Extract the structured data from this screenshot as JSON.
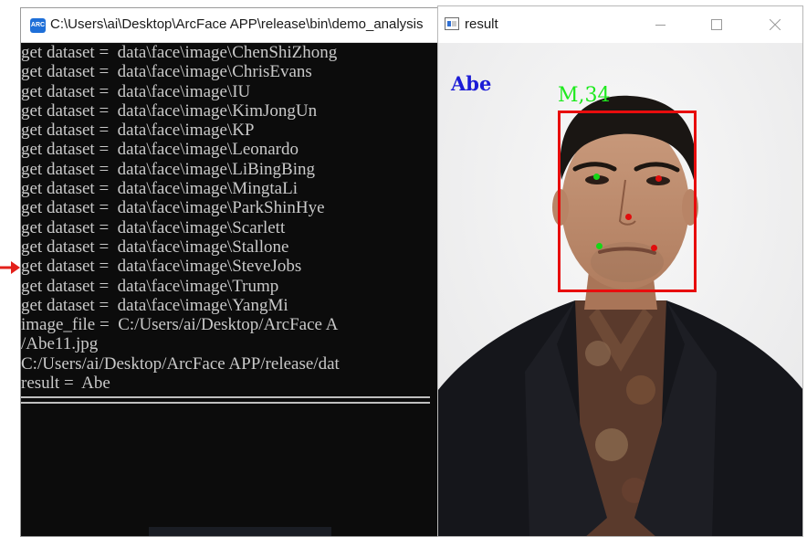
{
  "console": {
    "title": "C:\\Users\\ai\\Desktop\\ArcFace APP\\release\\bin\\demo_analysis",
    "app_icon": "arcface-app-icon",
    "lines": [
      "get dataset =  data\\face\\image\\ChenShiZhong",
      "get dataset =  data\\face\\image\\ChrisEvans",
      "get dataset =  data\\face\\image\\IU",
      "get dataset =  data\\face\\image\\KimJongUn",
      "get dataset =  data\\face\\image\\KP",
      "get dataset =  data\\face\\image\\Leonardo",
      "get dataset =  data\\face\\image\\LiBingBing",
      "get dataset =  data\\face\\image\\MingtaLi",
      "get dataset =  data\\face\\image\\ParkShinHye",
      "get dataset =  data\\face\\image\\Scarlett",
      "get dataset =  data\\face\\image\\Stallone",
      "get dataset =  data\\face\\image\\SteveJobs",
      "get dataset =  data\\face\\image\\Trump",
      "get dataset =  data\\face\\image\\YangMi",
      "image_file =  C:/Users/ai/Desktop/ArcFace A",
      "/Abe11.jpg",
      "C:/Users/ai/Desktop/ArcFace APP/release/dat",
      "result =  Abe"
    ]
  },
  "result_window": {
    "title": "result",
    "predicted_name": "Abe",
    "face_label": "M,34",
    "colors": {
      "name_text": "#1c1cd6",
      "face_label": "#1eea1e",
      "face_box": "#e80d0d",
      "landmark_green": "#16d616",
      "landmark_red": "#e00d0d"
    }
  }
}
